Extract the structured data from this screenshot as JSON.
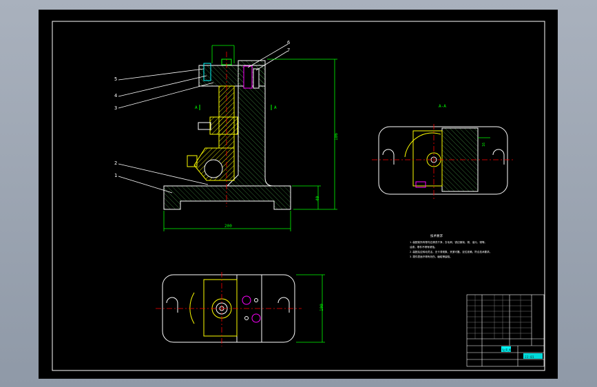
{
  "balloons": [
    "5",
    "4",
    "3",
    "2",
    "1",
    "6",
    "7"
  ],
  "section_label": "A-A",
  "cut_marks": [
    "A",
    "A"
  ],
  "dimensions": {
    "base_width": "200",
    "total_height": "186",
    "base_height": "40",
    "plan_depth": "100",
    "section_small": "16"
  },
  "notes": {
    "title": "技术要求",
    "lines": [
      "1.装配前所有零件应清洗干净，去毛刺、锐边倒钝、锈、油污、锈等。",
      "  油漆。零件不得有锈蚀。",
      "2.装配后应转动灵活，无卡滞现象，夹紧可靠，定位准确，符合技术要求。",
      "3.零件表面不得有划伤、磕碰等缺陷。"
    ]
  },
  "title_block": {
    "drawing_name": "钻夹具",
    "drawing_code": "JJ-01"
  },
  "colors": {
    "background": "#000000",
    "lines": "#ffffff",
    "hatch": "#ffff00",
    "dims": "#00ff00",
    "centerlines": "#ff0000",
    "highlight": "#ff00ff",
    "accent": "#00ffff"
  }
}
